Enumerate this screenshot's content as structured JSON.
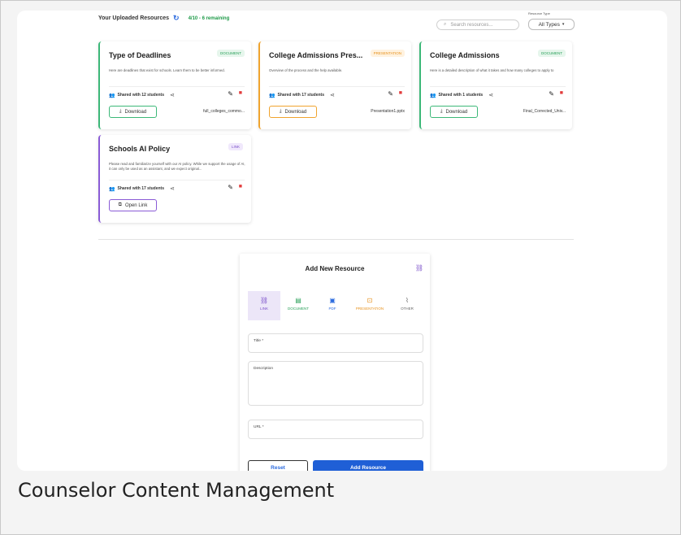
{
  "header": {
    "title": "Your Uploaded Resources",
    "remaining": "4/10 - 6 remaining",
    "search_placeholder": "Search resources...",
    "type_label": "Resource Type",
    "type_selected": "All Types"
  },
  "cards": [
    {
      "title": "Type of Deadlines",
      "badge": "DOCUMENT",
      "description": "Here are deadlines that exist for schools. Learn them to be better informed.",
      "shared": "Shared with 12 students",
      "button": "Download",
      "file": "full_colleges_commo..."
    },
    {
      "title": "College Admissions Pres...",
      "badge": "PRESENTATION",
      "description": "Overview of the process and the help available.",
      "shared": "Shared with 17 students",
      "button": "Download",
      "file": "Presentation1.pptx"
    },
    {
      "title": "College Admissions",
      "badge": "DOCUMENT",
      "description": "Here is a detailed description of what it takes and how many colleges to apply to",
      "shared": "Shared with 1 students",
      "button": "Download",
      "file": "Final_Corrected_Univ..."
    },
    {
      "title": "Schools AI Policy",
      "badge": "LINK",
      "description": "Please read and familiarize yourself with our AI policy. While we support the usage of AI, it can only be used as an assistant, and we expect original...",
      "shared": "Shared with 17 students",
      "button": "Open Link",
      "file": ""
    }
  ],
  "form": {
    "title": "Add New Resource",
    "types": [
      "LINK",
      "DOCUMENT",
      "PDF",
      "PRESENTATION",
      "OTHER"
    ],
    "title_field": "Title *",
    "description_field": "Description",
    "url_field": "URL *",
    "reset": "Reset",
    "add": "Add Resource"
  },
  "caption": "Counselor Content Management"
}
